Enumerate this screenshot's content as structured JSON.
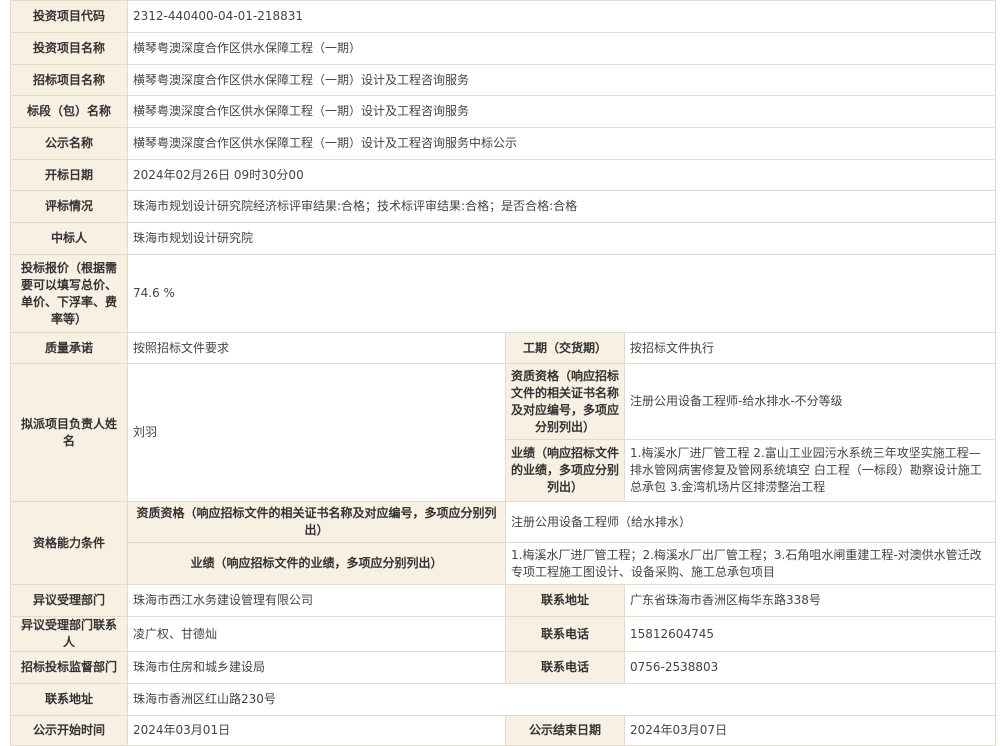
{
  "rows": {
    "project_code": {
      "label": "投资项目代码",
      "value": "2312-440400-04-01-218831"
    },
    "project_name": {
      "label": "投资项目名称",
      "value": "横琴粤澳深度合作区供水保障工程（一期）"
    },
    "tender_name": {
      "label": "招标项目名称",
      "value": "横琴粤澳深度合作区供水保障工程（一期）设计及工程咨询服务"
    },
    "section_name": {
      "label": "标段（包）名称",
      "value": "横琴粤澳深度合作区供水保障工程（一期）设计及工程咨询服务"
    },
    "notice_name": {
      "label": "公示名称",
      "value": "横琴粤澳深度合作区供水保障工程（一期）设计及工程咨询服务中标公示"
    },
    "open_date": {
      "label": "开标日期",
      "value": "2024年02月26日 09时30分00"
    },
    "evaluation": {
      "label": "评标情况",
      "value": "珠海市规划设计研究院经济标评审结果:合格；技术标评审结果:合格；是否合格:合格"
    },
    "winner": {
      "label": "中标人",
      "value": "珠海市规划设计研究院"
    },
    "bid_price": {
      "label": "投标报价（根据需要可以填写总价、单价、下浮率、费率等）",
      "value": "74.6 %"
    },
    "quality": {
      "label": "质量承诺",
      "value": "按照招标文件要求",
      "label2": "工期（交货期）",
      "value2": "按招标文件执行"
    },
    "manager": {
      "label": "拟派项目负责人姓名",
      "value": "刘羽",
      "qual_label": "资质资格（响应招标文件的相关证书名称及对应编号，多项应分别列出）",
      "qual_value": "注册公用设备工程师-给水排水-不分等级",
      "perf_label": "业绩（响应招标文件的业绩，多项应分别列出）",
      "perf_value": "1.梅溪水厂进厂管工程 2.富山工业园污水系统三年攻坚实施工程—排水管网病害修复及管网系统填空 白工程（一标段）勘察设计施工总承包 3.金湾机场片区排涝整治工程"
    },
    "capability": {
      "label": "资格能力条件",
      "qual_label": "资质资格（响应招标文件的相关证书名称及对应编号，多项应分别列出）",
      "qual_value": "注册公用设备工程师（给水排水）",
      "perf_label": "业绩（响应招标文件的业绩，多项应分别列出）",
      "perf_value": "1.梅溪水厂进厂管工程；2.梅溪水厂出厂管工程；3.石角咀水闸重建工程-对澳供水管迁改专项工程施工图设计、设备采购、施工总承包项目"
    },
    "objection_dept": {
      "label": "异议受理部门",
      "value": "珠海市西江水务建设管理有限公司",
      "label2": "联系地址",
      "value2": "广东省珠海市香洲区梅华东路338号"
    },
    "objection_contact": {
      "label": "异议受理部门联系人",
      "value": "凌广权、甘德灿",
      "label2": "联系电话",
      "value2": "15812604745"
    },
    "supervisor": {
      "label": "招标投标监督部门",
      "value": "珠海市住房和城乡建设局",
      "label2": "联系电话",
      "value2": "0756-2538803"
    },
    "address": {
      "label": "联系地址",
      "value": "珠海市香洲区红山路230号"
    },
    "publicity": {
      "label": "公示开始时间",
      "value": "2024年03月01日",
      "label2": "公示结束日期",
      "value2": "2024年03月07日"
    }
  }
}
